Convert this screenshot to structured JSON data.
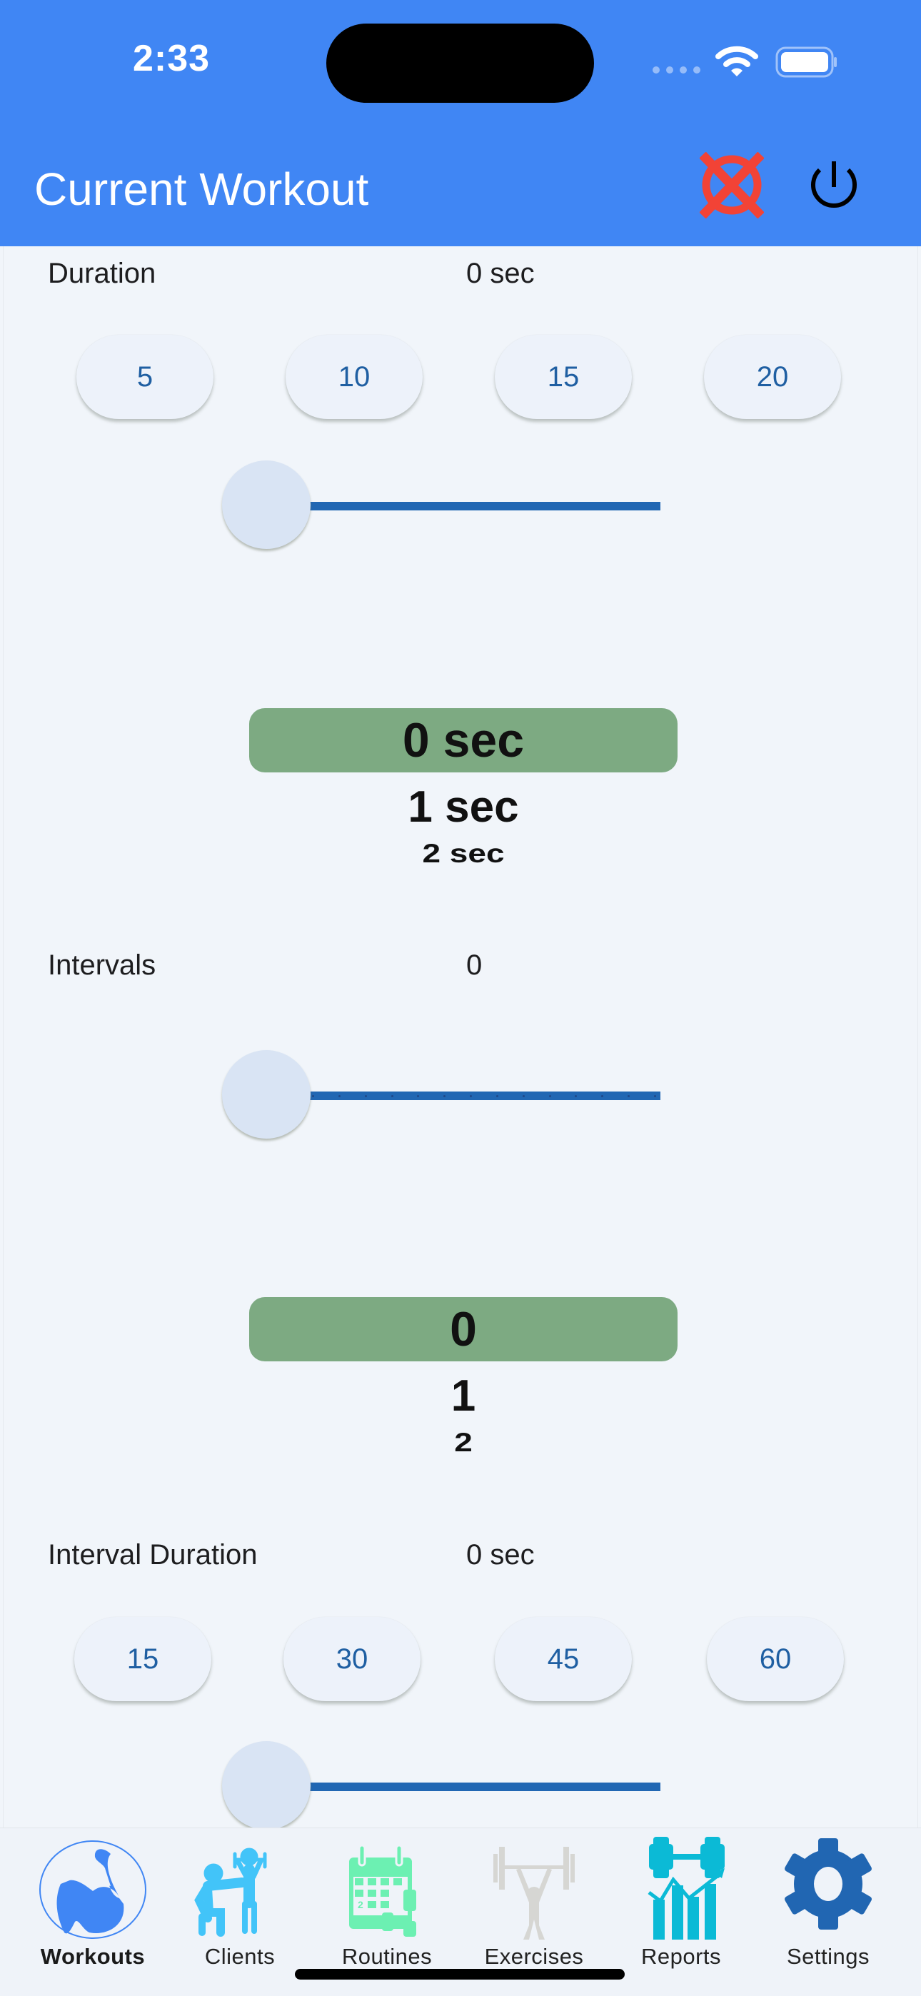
{
  "status_bar": {
    "time": "2:33"
  },
  "header": {
    "title": "Current Workout",
    "clear_icon": "clear-x-circle-icon",
    "power_icon": "power-icon",
    "colors": {
      "background": "#4086f4",
      "clear": "#f24336",
      "power": "#000000"
    }
  },
  "duration": {
    "label": "Duration",
    "value": "0 sec",
    "presets": [
      "5",
      "10",
      "15",
      "20"
    ],
    "slider_value": 0,
    "picker": {
      "selected": "0 sec",
      "next1": "1 sec",
      "next2": "2 sec"
    }
  },
  "intervals": {
    "label": "Intervals",
    "value": "0",
    "slider_value": 0,
    "picker": {
      "selected": "0",
      "next1": "1",
      "next2": "2"
    }
  },
  "interval_duration": {
    "label": "Interval Duration",
    "value": "0 sec",
    "presets": [
      "15",
      "30",
      "45",
      "60"
    ],
    "slider_value": 0
  },
  "tabbar": {
    "items": [
      {
        "label": "Workouts",
        "icon": "flexed-bicep-icon",
        "active": true
      },
      {
        "label": "Clients",
        "icon": "trainer-client-icon",
        "active": false
      },
      {
        "label": "Routines",
        "icon": "calendar-dumbbell-icon",
        "active": false
      },
      {
        "label": "Exercises",
        "icon": "weightlifter-icon",
        "active": false
      },
      {
        "label": "Reports",
        "icon": "dumbbell-chart-icon",
        "active": false
      },
      {
        "label": "Settings",
        "icon": "gear-icon",
        "active": false
      }
    ]
  },
  "colors": {
    "picker_selected": "#7daa82",
    "slider_track": "#2167b3",
    "preset_text": "#1f5fa2"
  }
}
